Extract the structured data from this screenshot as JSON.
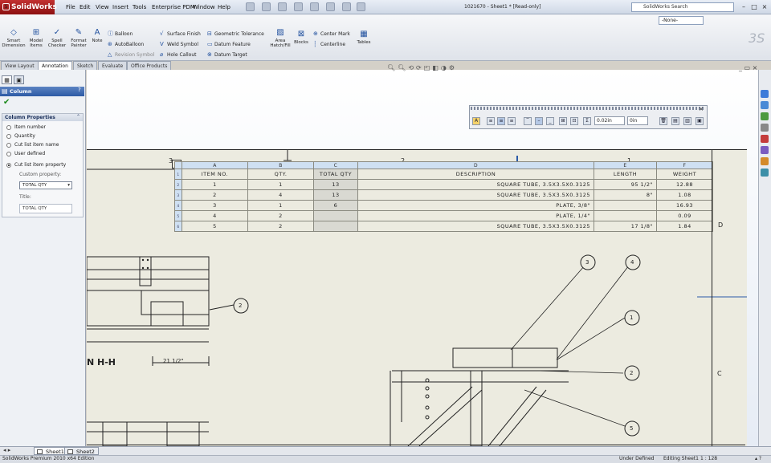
{
  "app": {
    "name": "SolidWorks",
    "window_title": "1021670 - Sheet1 * [Read-only]",
    "search_placeholder": "SolidWorks Search",
    "layer_select": "-None-"
  },
  "menu": [
    "File",
    "Edit",
    "View",
    "Insert",
    "Tools",
    "Enterprise PDM",
    "Window",
    "Help"
  ],
  "command_manager": {
    "big_buttons": [
      {
        "label": "Smart Dimension",
        "icon": "smart-dimension-icon"
      },
      {
        "label": "Model Items",
        "icon": "model-items-icon"
      },
      {
        "label": "Spell Checker",
        "icon": "spell-checker-icon"
      },
      {
        "label": "Format Painter",
        "icon": "format-painter-icon"
      },
      {
        "label": "Note",
        "icon": "note-icon"
      }
    ],
    "col1": [
      "Balloon",
      "AutoBalloon",
      "Revision Symbol"
    ],
    "col2": [
      "Surface Finish",
      "Weld Symbol",
      "Hole Callout"
    ],
    "col3": [
      "Geometric Tolerance",
      "Datum Feature",
      "Datum Target"
    ],
    "area_hatch": "Area Hatch/Fill",
    "blocks": "Blocks",
    "col4": [
      "Center Mark",
      "Centerline"
    ],
    "tables": "Tables"
  },
  "tabs": [
    "View Layout",
    "Annotation",
    "Sketch",
    "Evaluate",
    "Office Products"
  ],
  "active_tab": "Annotation",
  "property_manager": {
    "title": "Column",
    "group_title": "Column Properties",
    "options": [
      "Item number",
      "Quantity",
      "Cut list item name",
      "User defined",
      "Cut list item property"
    ],
    "selected_option": "Cut list item property",
    "custom_property_label": "Custom property:",
    "custom_property_value": "TOTAL QTY",
    "title_label": "Title:",
    "title_value": "TOTAL QTY"
  },
  "format_toolbar": {
    "spacing_value": "0.02in",
    "offset_value": "0in"
  },
  "bom": {
    "column_letters": [
      "A",
      "B",
      "C",
      "D",
      "E",
      "F"
    ],
    "headers": [
      "ITEM NO.",
      "QTY.",
      "TOTAL QTY",
      "DESCRIPTION",
      "LENGTH",
      "WEIGHT"
    ],
    "rows": [
      [
        "1",
        "1",
        "13",
        "SQUARE TUBE, 3.5X3.5X0.3125",
        "95 1/2\"",
        "12.88"
      ],
      [
        "2",
        "4",
        "13",
        "SQUARE TUBE, 3.5X3.5X0.3125",
        "8\"",
        "1.08"
      ],
      [
        "3",
        "1",
        "6",
        "PLATE, 3/8\"",
        "",
        "16.93"
      ],
      [
        "4",
        "2",
        "",
        "PLATE, 1/4\"",
        "",
        "0.09"
      ],
      [
        "5",
        "2",
        "",
        "SQUARE TUBE, 3.5X3.5X0.3125",
        "17 1/8\"",
        "1.84"
      ]
    ]
  },
  "drawing": {
    "zone_top": [
      "3",
      "2",
      "1"
    ],
    "zone_right": [
      "D",
      "C"
    ],
    "section_label": "N H-H",
    "dimension": "21 1/2\"",
    "balloons": [
      "2",
      "3",
      "4",
      "1",
      "2",
      "5"
    ]
  },
  "sheet_tabs": [
    "Sheet1",
    "Sheet2"
  ],
  "status": {
    "edition": "SolidWorks Premium 2010 x64 Edition",
    "state": "Under Defined",
    "editing": "Editing Sheet1",
    "scale": "1 : 128"
  }
}
